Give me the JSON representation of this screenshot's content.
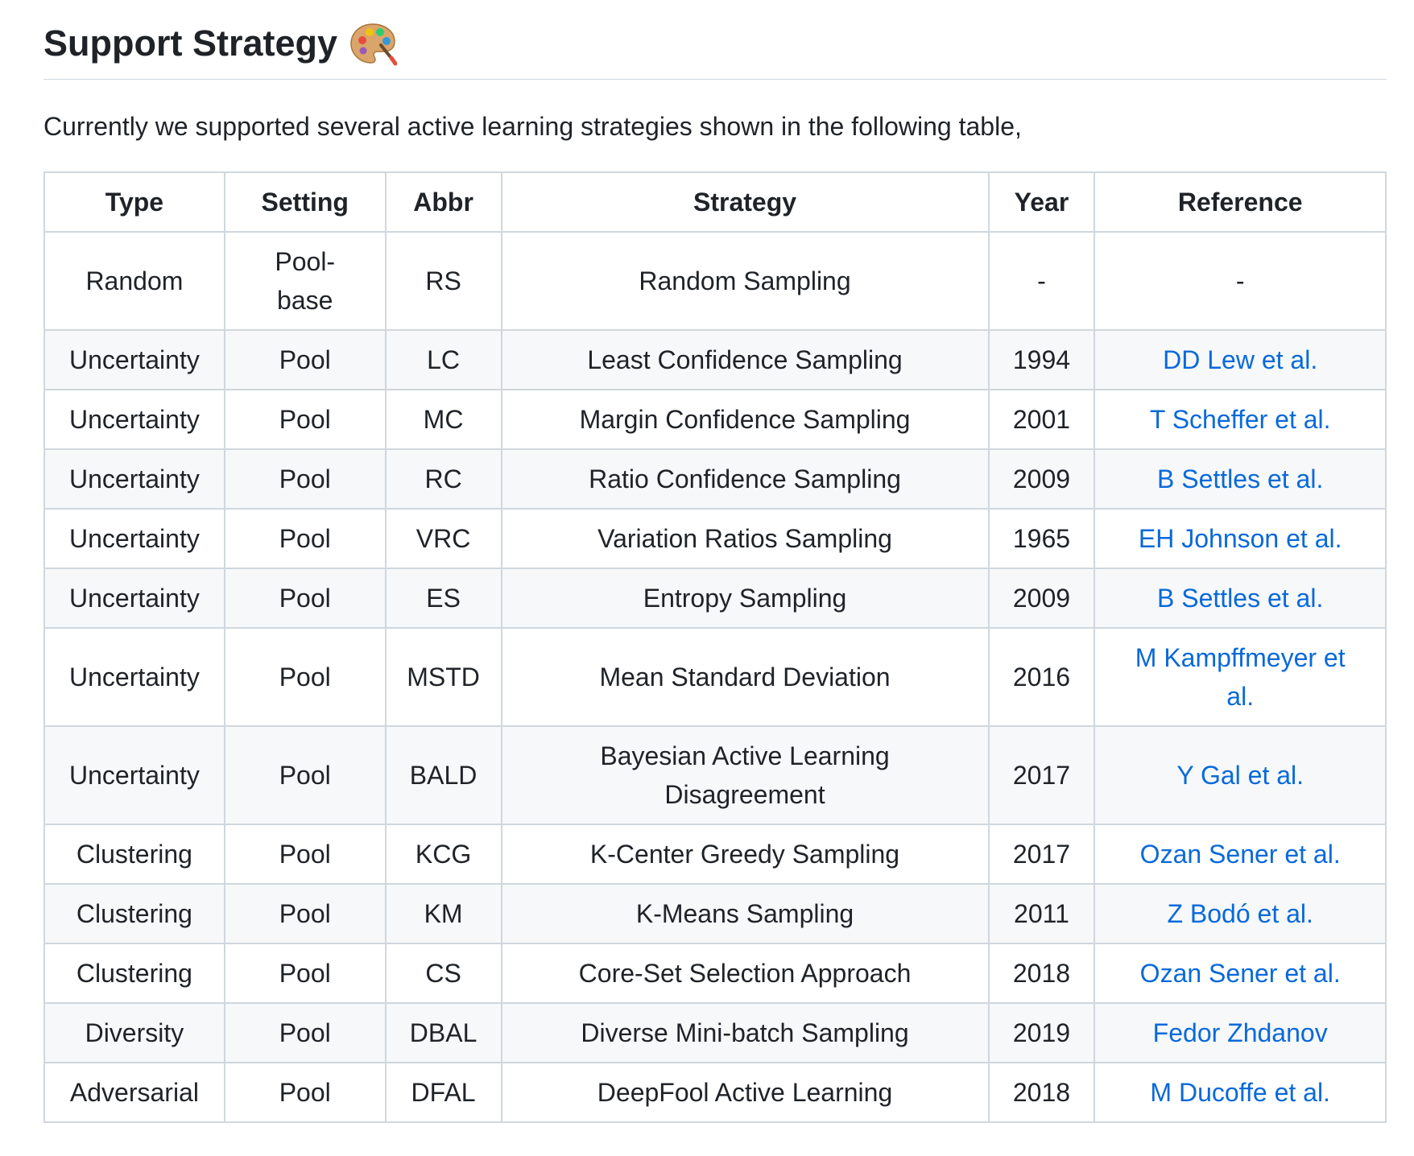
{
  "heading": {
    "title": "Support Strategy",
    "emoji_icon": "artist-palette-icon"
  },
  "intro_text": "Currently we supported several active learning strategies shown in the following table,",
  "table": {
    "headers": [
      "Type",
      "Setting",
      "Abbr",
      "Strategy",
      "Year",
      "Reference"
    ],
    "rows": [
      {
        "type": "Random",
        "setting": "Pool-base",
        "abbr": "RS",
        "strategy": "Random Sampling",
        "year": "-",
        "reference": "-",
        "is_link": false
      },
      {
        "type": "Uncertainty",
        "setting": "Pool",
        "abbr": "LC",
        "strategy": "Least Confidence Sampling",
        "year": "1994",
        "reference": "DD Lew et al.",
        "is_link": true
      },
      {
        "type": "Uncertainty",
        "setting": "Pool",
        "abbr": "MC",
        "strategy": "Margin Confidence Sampling",
        "year": "2001",
        "reference": "T Scheffer et al.",
        "is_link": true
      },
      {
        "type": "Uncertainty",
        "setting": "Pool",
        "abbr": "RC",
        "strategy": "Ratio Confidence Sampling",
        "year": "2009",
        "reference": "B Settles et al.",
        "is_link": true
      },
      {
        "type": "Uncertainty",
        "setting": "Pool",
        "abbr": "VRC",
        "strategy": "Variation Ratios Sampling",
        "year": "1965",
        "reference": "EH Johnson et al.",
        "is_link": true
      },
      {
        "type": "Uncertainty",
        "setting": "Pool",
        "abbr": "ES",
        "strategy": "Entropy Sampling",
        "year": "2009",
        "reference": "B Settles et al.",
        "is_link": true
      },
      {
        "type": "Uncertainty",
        "setting": "Pool",
        "abbr": "MSTD",
        "strategy": "Mean Standard Deviation",
        "year": "2016",
        "reference": "M Kampffmeyer et al.",
        "is_link": true
      },
      {
        "type": "Uncertainty",
        "setting": "Pool",
        "abbr": "BALD",
        "strategy": "Bayesian Active Learning Disagreement",
        "year": "2017",
        "reference": "Y Gal et al.",
        "is_link": true
      },
      {
        "type": "Clustering",
        "setting": "Pool",
        "abbr": "KCG",
        "strategy": "K-Center Greedy Sampling",
        "year": "2017",
        "reference": "Ozan Sener et al.",
        "is_link": true
      },
      {
        "type": "Clustering",
        "setting": "Pool",
        "abbr": "KM",
        "strategy": "K-Means Sampling",
        "year": "2011",
        "reference": "Z Bodó et al.",
        "is_link": true
      },
      {
        "type": "Clustering",
        "setting": "Pool",
        "abbr": "CS",
        "strategy": "Core-Set Selection Approach",
        "year": "2018",
        "reference": "Ozan Sener et al.",
        "is_link": true
      },
      {
        "type": "Diversity",
        "setting": "Pool",
        "abbr": "DBAL",
        "strategy": "Diverse Mini-batch Sampling",
        "year": "2019",
        "reference": "Fedor Zhdanov",
        "is_link": true
      },
      {
        "type": "Adversarial",
        "setting": "Pool",
        "abbr": "DFAL",
        "strategy": "DeepFool Active Learning",
        "year": "2018",
        "reference": "M Ducoffe et al.",
        "is_link": true
      }
    ]
  },
  "colors": {
    "link": "#0969da",
    "border": "#d0d7de",
    "stripe": "#f6f8fa",
    "text": "#1f2328"
  }
}
